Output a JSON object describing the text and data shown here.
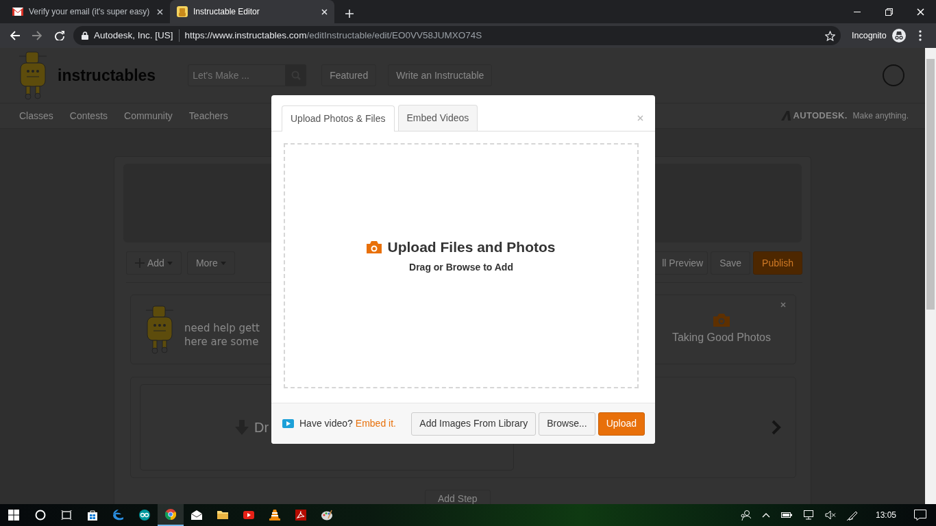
{
  "browser": {
    "tabs": [
      {
        "title": "Verify your email (it's super easy)",
        "kind": "mail",
        "selected": false
      },
      {
        "title": "Instructable Editor",
        "kind": "robot",
        "selected": true
      }
    ],
    "site_identity": "Autodesk, Inc. [US]",
    "url_host": "https://www.instructables.com",
    "url_path": "/editInstructable/edit/EO0VV58JUMXO74S",
    "profile_label": "Incognito"
  },
  "site_header": {
    "logo_text": "instructables",
    "search_placeholder": "Let's Make ...",
    "buttons": [
      "Featured",
      "Write an Instructable"
    ]
  },
  "site_nav": {
    "items": [
      "Classes",
      "Contests",
      "Community",
      "Teachers"
    ],
    "brand": "AUTODESK.",
    "tagline": "Make anything."
  },
  "editor": {
    "toolbar_left": [
      "Add",
      "More"
    ],
    "toolbar_right": [
      {
        "label": "ll Preview",
        "kind": "plain"
      },
      {
        "label": "Save",
        "kind": "plain"
      },
      {
        "label": "Publish",
        "kind": "primary"
      }
    ],
    "help_text_lines": [
      "need help gett",
      "here are some"
    ],
    "help_topic": "Taking Good Photos",
    "drop_text": "Dr",
    "add_step": "Add Step"
  },
  "modal": {
    "tabs": [
      {
        "label": "Upload Photos & Files",
        "selected": true
      },
      {
        "label": "Embed Videos",
        "selected": false
      }
    ],
    "drop_title": "Upload Files and Photos",
    "drop_subtitle": "Drag or Browse to Add",
    "video_prompt": "Have video?",
    "embed_link": "Embed it.",
    "buttons": [
      {
        "label": "Add Images From Library",
        "kind": "default"
      },
      {
        "label": "Browse...",
        "kind": "default"
      },
      {
        "label": "Upload",
        "kind": "primary"
      }
    ]
  },
  "taskbar": {
    "apps": [
      {
        "kind": "store",
        "selected": false
      },
      {
        "kind": "edge",
        "selected": false
      },
      {
        "kind": "arduino",
        "selected": false
      },
      {
        "kind": "chrome",
        "selected": true
      },
      {
        "kind": "mail",
        "selected": false
      },
      {
        "kind": "folder",
        "selected": false
      },
      {
        "kind": "youtube",
        "selected": false
      },
      {
        "kind": "vlc",
        "selected": false
      },
      {
        "kind": "acrobat",
        "selected": false
      },
      {
        "kind": "paint",
        "selected": false
      }
    ],
    "clock": "13:05"
  }
}
